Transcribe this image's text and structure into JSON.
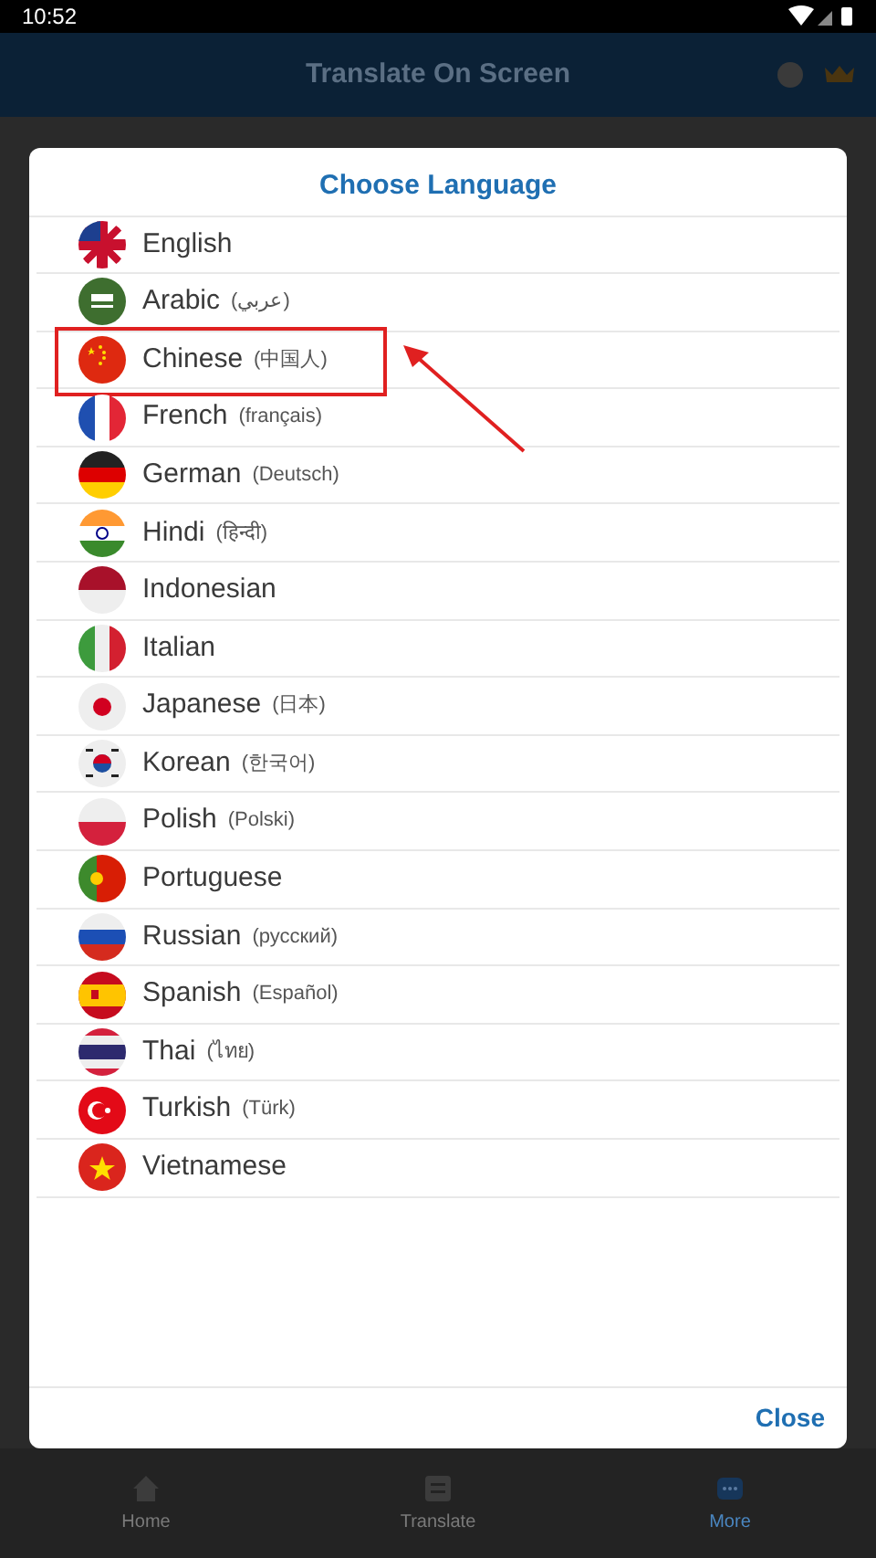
{
  "status_bar": {
    "time": "10:52"
  },
  "app_bar": {
    "title": "Translate On Screen"
  },
  "dialog": {
    "title": "Choose Language",
    "languages": [
      {
        "name": "English",
        "highlighted": false
      },
      {
        "name": "Arabic",
        "native": "(عربي)",
        "highlighted": false
      },
      {
        "name": "Chinese",
        "native": "(中国人)",
        "highlighted": true
      },
      {
        "name": "French",
        "native": "(français)",
        "highlighted": false
      },
      {
        "name": "German",
        "native": "(Deutsch)",
        "highlighted": false
      },
      {
        "name": "Hindi",
        "native": "(हिन्दी)",
        "highlighted": false
      },
      {
        "name": "Indonesian",
        "highlighted": false
      },
      {
        "name": "Italian",
        "highlighted": false
      },
      {
        "name": "Japanese",
        "native": "(日本)",
        "highlighted": false
      },
      {
        "name": "Korean",
        "native": "(한국어)",
        "highlighted": false
      },
      {
        "name": "Polish",
        "native": "(Polski)",
        "highlighted": false
      },
      {
        "name": "Portuguese",
        "highlighted": false
      },
      {
        "name": "Russian",
        "native": "(русский)",
        "highlighted": false
      },
      {
        "name": "Spanish",
        "native": "(Español)",
        "highlighted": false
      },
      {
        "name": "Thai",
        "native": "(ไทย)",
        "highlighted": false
      },
      {
        "name": "Turkish",
        "native": "(Türk)",
        "highlighted": false
      },
      {
        "name": "Vietnamese",
        "highlighted": false
      }
    ],
    "close_button": "Close"
  },
  "bottom_nav": [
    {
      "label": "Home",
      "selected": false
    },
    {
      "label": "Translate",
      "selected": false
    },
    {
      "label": "More",
      "selected": true
    }
  ]
}
